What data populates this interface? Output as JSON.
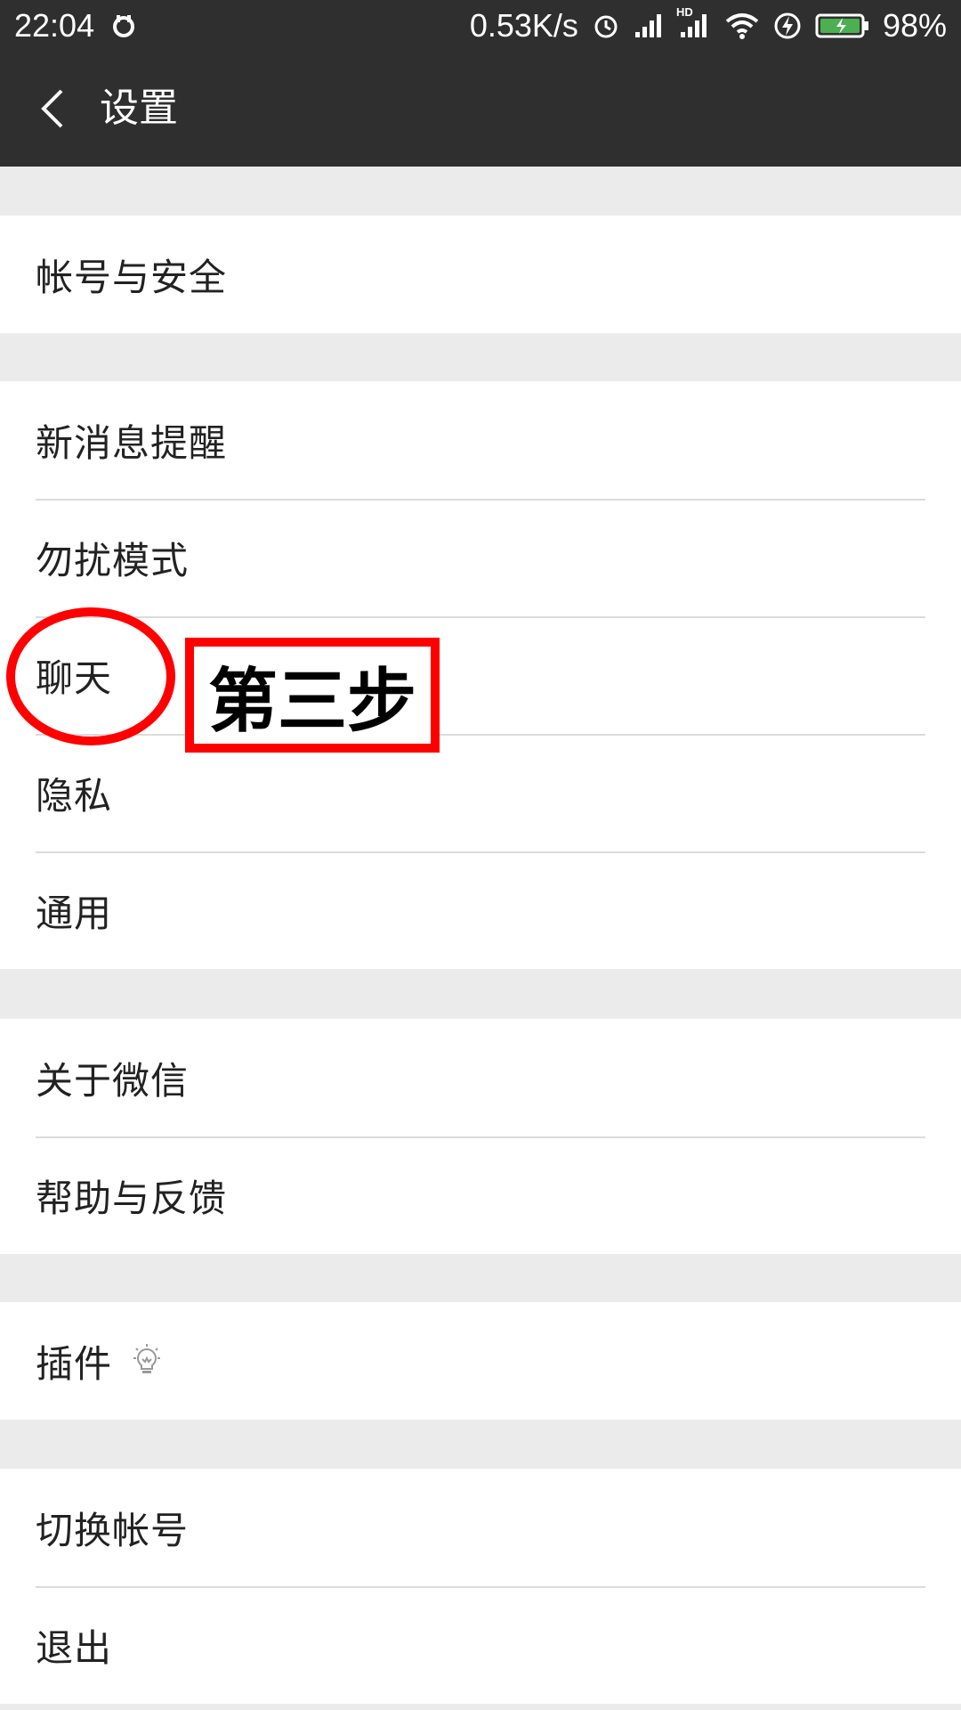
{
  "status_bar": {
    "time": "22:04",
    "net_speed": "0.53K/s",
    "hd_label": "HD",
    "battery": "98%",
    "icons": [
      "notification-icon",
      "alarm-icon",
      "signal-icon",
      "signal-hd-icon",
      "wifi-icon",
      "charging-icon",
      "battery-icon"
    ]
  },
  "nav": {
    "title": "设置",
    "back_icon": "chevron-left-icon"
  },
  "sections": [
    {
      "items": [
        {
          "label": "帐号与安全"
        }
      ]
    },
    {
      "items": [
        {
          "label": "新消息提醒"
        },
        {
          "label": "勿扰模式"
        },
        {
          "label": "聊天"
        },
        {
          "label": "隐私"
        },
        {
          "label": "通用"
        }
      ]
    },
    {
      "items": [
        {
          "label": "关于微信"
        },
        {
          "label": "帮助与反馈"
        }
      ]
    },
    {
      "items": [
        {
          "label": "插件",
          "icon": "lightbulb-icon"
        }
      ]
    },
    {
      "items": [
        {
          "label": "切换帐号"
        },
        {
          "label": "退出"
        }
      ]
    }
  ],
  "annotation": {
    "text": "第三步",
    "color": "#ff0000"
  },
  "colors": {
    "bar": "#2f2f2f",
    "background": "#ebebeb",
    "battery_fill": "#4caf50"
  }
}
